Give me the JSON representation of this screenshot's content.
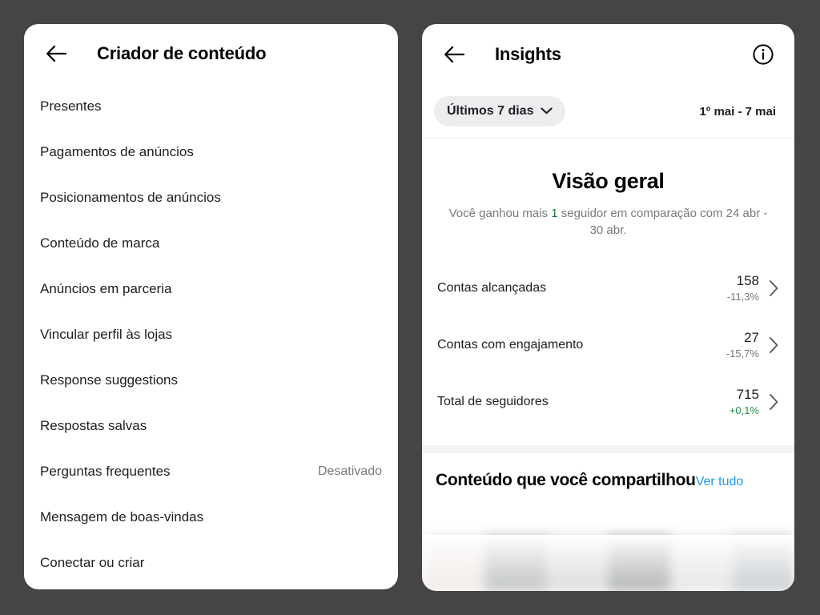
{
  "theme": {
    "background": "#454545",
    "panel_bg": "#ffffff",
    "accent_link": "#1d9bf0",
    "positive": "#2a8a4a",
    "muted": "#76797e",
    "pill_bg": "#ebedef"
  },
  "left_panel": {
    "back_icon": "back-arrow-icon",
    "title": "Criador de conteúdo",
    "items": [
      {
        "label": "Presentes",
        "value": ""
      },
      {
        "label": "Pagamentos de anúncios",
        "value": ""
      },
      {
        "label": "Posicionamentos de anúncios",
        "value": ""
      },
      {
        "label": "Conteúdo de marca",
        "value": ""
      },
      {
        "label": "Anúncios em parceria",
        "value": ""
      },
      {
        "label": "Vincular perfil às lojas",
        "value": ""
      },
      {
        "label": "Response suggestions",
        "value": ""
      },
      {
        "label": "Respostas salvas",
        "value": ""
      },
      {
        "label": "Perguntas frequentes",
        "value": "Desativado"
      },
      {
        "label": "Mensagem de boas-vindas",
        "value": ""
      },
      {
        "label": "Conectar ou criar",
        "value": ""
      }
    ]
  },
  "right_panel": {
    "back_icon": "back-arrow-icon",
    "title": "Insights",
    "info_icon": "info-circle-icon",
    "range_pill": {
      "label": "Últimos 7 dias",
      "chevron_icon": "chevron-down-icon"
    },
    "date_range": "1º mai - 7 mai",
    "overview": {
      "title": "Visão geral",
      "subtitle_before": "Você ganhou mais ",
      "subtitle_highlight": "1",
      "subtitle_after": " seguidor em comparação com 24 abr - 30 abr."
    },
    "metrics": [
      {
        "label": "Contas alcançadas",
        "value": "158",
        "delta": "-11,3%",
        "delta_positive": false
      },
      {
        "label": "Contas com engajamento",
        "value": "27",
        "delta": "-15,7%",
        "delta_positive": false
      },
      {
        "label": "Total de seguidores",
        "value": "715",
        "delta": "+0,1%",
        "delta_positive": true
      }
    ],
    "shared_section": {
      "title": "Conteúdo que você compartilhou",
      "link": "Ver tudo",
      "thumbnails": [
        {
          "color": "#efe8e4"
        },
        {
          "color": "#b9bcbe"
        },
        {
          "color": "#d7d9db"
        },
        {
          "color": "#a9acae"
        },
        {
          "color": "#e2e4e6"
        },
        {
          "color": "#c3c8cc"
        }
      ]
    }
  }
}
